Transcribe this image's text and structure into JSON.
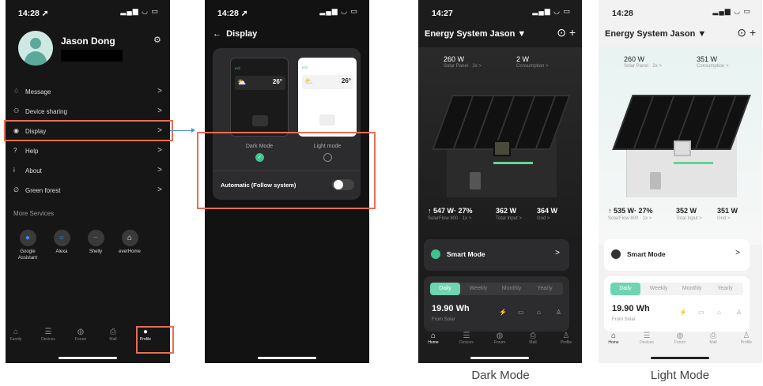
{
  "phone1": {
    "time": "14:28 ➚",
    "signal": "▂▄▆ ◡ ▭",
    "user": {
      "name": "Jason Dong"
    },
    "menu": [
      {
        "label": "Message",
        "icon": "bell-icon",
        "glyph": "♢"
      },
      {
        "label": "Device sharing",
        "icon": "share-icon",
        "glyph": "⚇"
      },
      {
        "label": "Display",
        "icon": "eye-icon",
        "glyph": "◉"
      },
      {
        "label": "Help",
        "icon": "help-icon",
        "glyph": "?"
      },
      {
        "label": "About",
        "icon": "info-icon",
        "glyph": "i"
      },
      {
        "label": "Green forest",
        "icon": "leaf-icon",
        "glyph": "∅"
      }
    ],
    "arrow": ">",
    "more_services": "More Services",
    "services": [
      {
        "label": "Google Assistant",
        "icon": "google-assistant-icon",
        "glyph": "●"
      },
      {
        "label": "Alexa",
        "icon": "alexa-icon",
        "glyph": "○"
      },
      {
        "label": "Shelly",
        "icon": "shelly-icon",
        "glyph": "~"
      },
      {
        "label": "everHome",
        "icon": "everhome-icon",
        "glyph": "⌂"
      }
    ],
    "tabs": [
      {
        "label": "Family",
        "icon": "home-icon",
        "glyph": "⌂"
      },
      {
        "label": "Devices",
        "icon": "devices-icon",
        "glyph": "☰"
      },
      {
        "label": "Forum",
        "icon": "forum-icon",
        "glyph": "◍"
      },
      {
        "label": "Mall",
        "icon": "bag-icon",
        "glyph": "⎙"
      },
      {
        "label": "Profile",
        "icon": "person-icon",
        "glyph": "●"
      }
    ]
  },
  "phone2": {
    "time": "14:28 ➚",
    "signal": "▂▄▆ ◡ ▭",
    "back": "←",
    "title": "Display",
    "dark_label": "Dark Mode",
    "light_label": "Light mode",
    "check": "✓",
    "auto_label": "Automatic (Follow system)",
    "preview": {
      "logo": "ℯ⊙",
      "temp": "26°"
    }
  },
  "phone3": {
    "time": "14:27",
    "signal": "▂▄▆ ◡ ▭",
    "title": "Energy System Jason ▼",
    "icons": "⊙ +",
    "solar": "260 W",
    "solar_sub": "Solar Panel · 2x >",
    "consumption": "2 W",
    "consumption_sub": "Consumption >",
    "flow": "↑ 547 W· 27%",
    "flow_sub": "SolarFlow 800 · 1x >",
    "input": "362 W",
    "input_sub": "Total Input >",
    "grid": "364 W",
    "grid_sub": "Grid >",
    "smart": "Smart Mode",
    "value": "19.90 Wh",
    "value_sub": "From Solar"
  },
  "phone4": {
    "time": "14:28",
    "signal": "▂▄▆ ◡ ▭",
    "title": "Energy System Jason ▼",
    "icons": "⊙ +",
    "solar": "260 W",
    "solar_sub": "Solar Panel · 2x >",
    "consumption": "351 W",
    "consumption_sub": "Consumption >",
    "flow": "↑ 535 W· 27%",
    "flow_sub": "SolarFlow 800 · 1x >",
    "input": "352 W",
    "input_sub": "Total Input >",
    "grid": "351 W",
    "grid_sub": "Grid >",
    "smart": "Smart Mode",
    "value": "19.90 Wh",
    "value_sub": "From Solar"
  },
  "periods": [
    "Daily",
    "Weekly",
    "Monthly",
    "Yearly"
  ],
  "etabs": [
    {
      "label": "Home",
      "glyph": "⌂"
    },
    {
      "label": "Devices",
      "glyph": "☰"
    },
    {
      "label": "Forum",
      "glyph": "◍"
    },
    {
      "label": "Mall",
      "glyph": "⎙"
    },
    {
      "label": "Profile",
      "glyph": "♙"
    }
  ],
  "captions": {
    "dark": "Dark Mode",
    "light": "Light Mode"
  },
  "colors": {
    "highlight": "#e86e52",
    "accent": "#3ec28f",
    "arrow": "#4a90d9"
  }
}
